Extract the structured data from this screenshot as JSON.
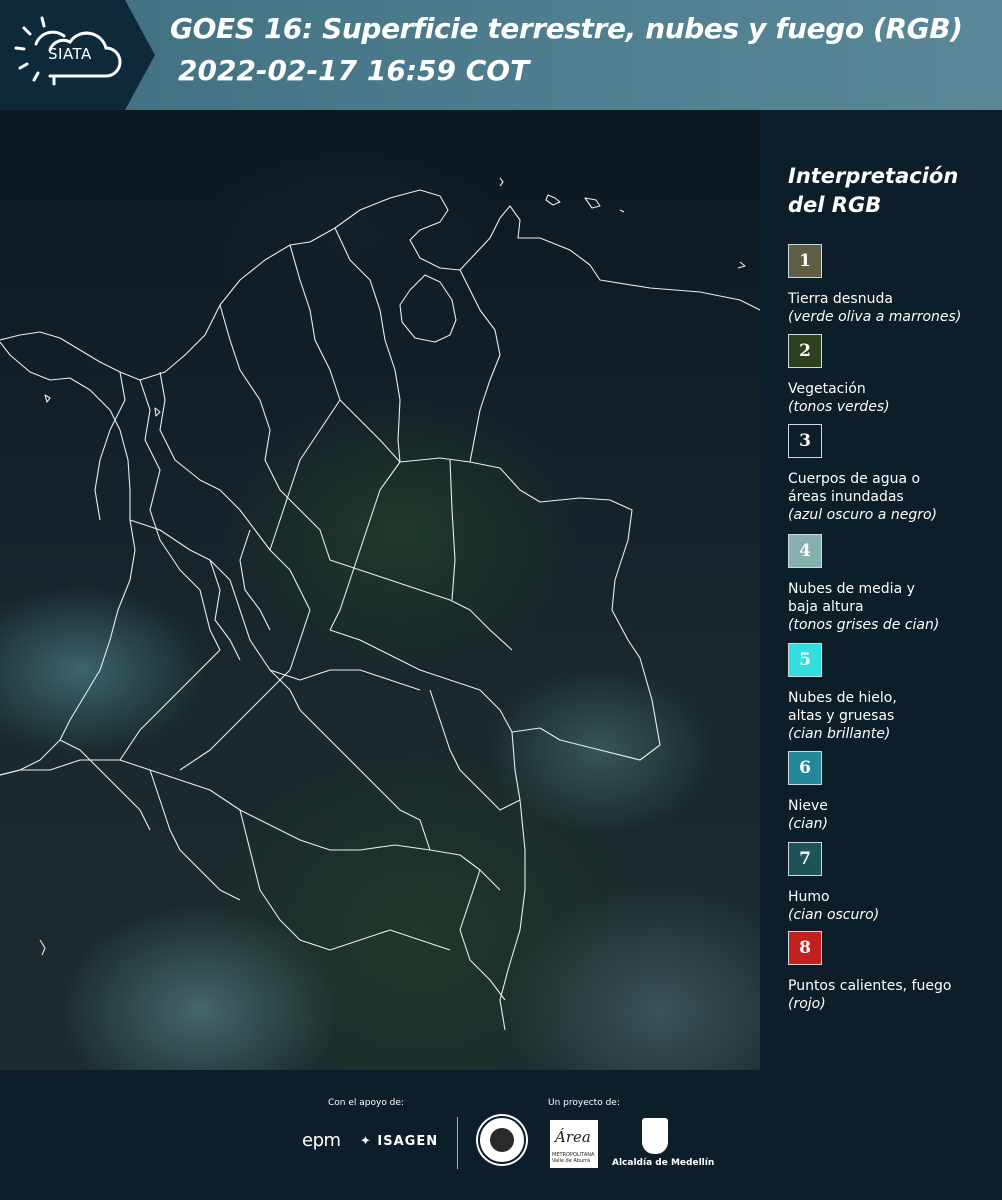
{
  "header": {
    "logo_text": "SIATA",
    "title_line1": "GOES 16: Superficie terrestre, nubes y fuego (RGB)",
    "title_line2": "2022-02-17 16:59 COT"
  },
  "legend": {
    "title": "Interpretación del RGB",
    "items": [
      {
        "number": "1",
        "color": "#5e5e45",
        "label": "Tierra desnuda",
        "sub": "(verde oliva a marrones)"
      },
      {
        "number": "2",
        "color": "#2f4020",
        "label": "Vegetación",
        "sub": "(tonos verdes)"
      },
      {
        "number": "3",
        "color": "#0b1e2a",
        "label": "Cuerpos de agua o áreas inundadas",
        "sub": "(azul oscuro a negro)"
      },
      {
        "number": "4",
        "color": "#86b0ae",
        "label": "Nubes de media y baja altura",
        "sub": "(tonos grises de cian)"
      },
      {
        "number": "5",
        "color": "#33dede",
        "label": "Nubes de hielo, altas y gruesas",
        "sub": "(cian brillante)"
      },
      {
        "number": "6",
        "color": "#23899a",
        "label": "Nieve",
        "sub": "(cian)"
      },
      {
        "number": "7",
        "color": "#1e5458",
        "label": "Humo",
        "sub": "(cian oscuro)"
      },
      {
        "number": "8",
        "color": "#c42020",
        "label": "Puntos calientes, fuego",
        "sub": "(rojo)"
      }
    ]
  },
  "footer": {
    "support_label": "Con el apoyo de:",
    "project_label": "Un proyecto de:",
    "sponsor1": "epm",
    "sponsor2": "ISAGEN",
    "partner_area": "Área",
    "partner_area_sub": "METROPOLITANA Valle de Aburrá",
    "partner_city": "Alcaldía de Medellín"
  }
}
